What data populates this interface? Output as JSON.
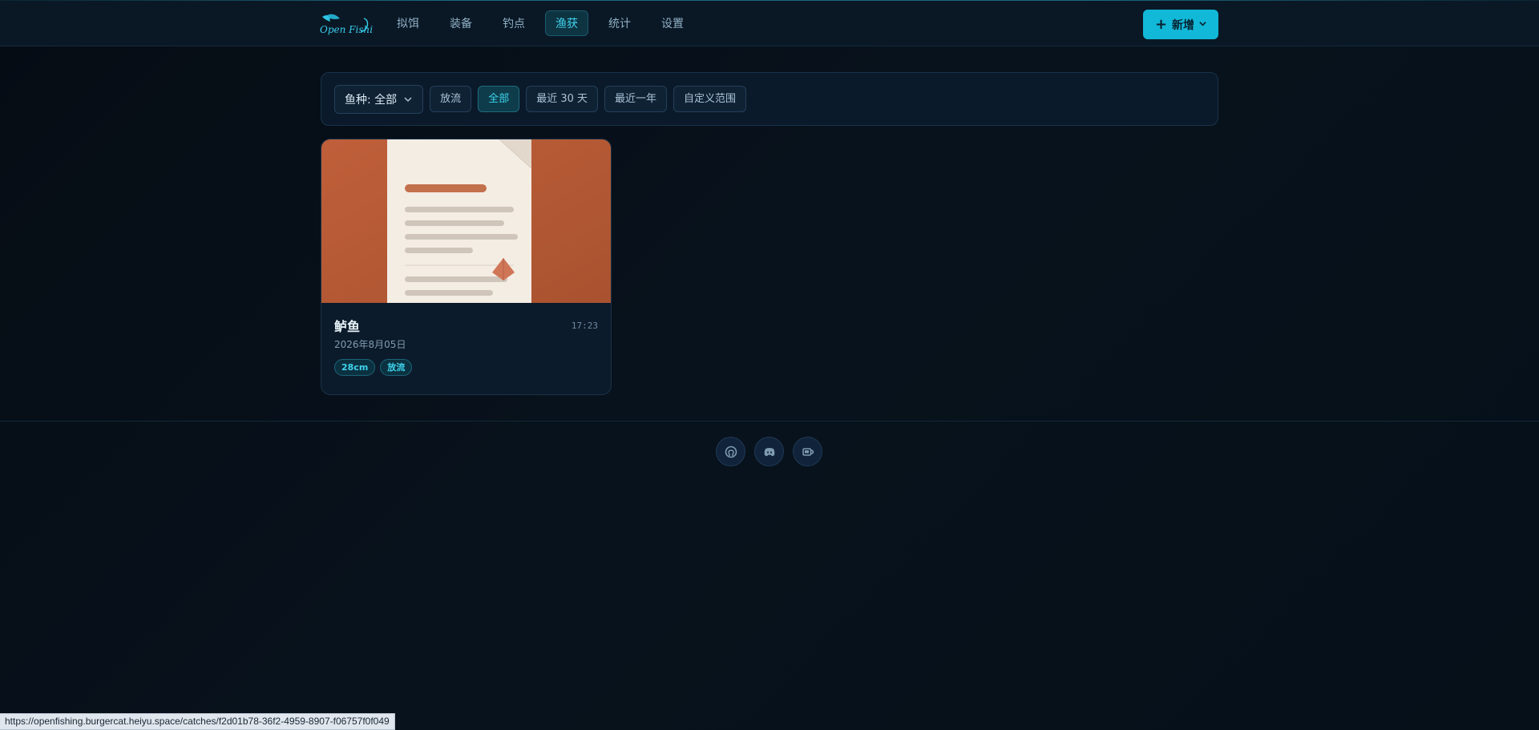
{
  "header": {
    "logo_text": "Open Fishing",
    "nav": [
      {
        "label": "拟饵"
      },
      {
        "label": "装备"
      },
      {
        "label": "钓点"
      },
      {
        "label": "渔获",
        "active": true
      },
      {
        "label": "统计"
      },
      {
        "label": "设置"
      }
    ],
    "add_button_label": "新增"
  },
  "filters": {
    "species_select": "鱼种: 全部",
    "chips": [
      {
        "label": "放流",
        "active": false
      },
      {
        "label": "全部",
        "active": true
      },
      {
        "label": "最近 30 天",
        "active": false
      },
      {
        "label": "最近一年",
        "active": false
      },
      {
        "label": "自定义范围",
        "active": false
      }
    ]
  },
  "catches": [
    {
      "title": "鲈鱼",
      "time": "17:23",
      "date": "2026年8月05日",
      "tags": [
        "28cm",
        "放流"
      ]
    }
  ],
  "footer": {
    "icons": [
      "github-icon",
      "discord-icon",
      "coffee-icon"
    ]
  },
  "status_url": "https://openfishing.burgercat.heiyu.space/catches/f2d01b78-36f2-4959-8907-f06757f0f049",
  "colors": {
    "accent": "#12b8d8",
    "background": "#07111b",
    "card_image_bg": "#b85c38"
  }
}
